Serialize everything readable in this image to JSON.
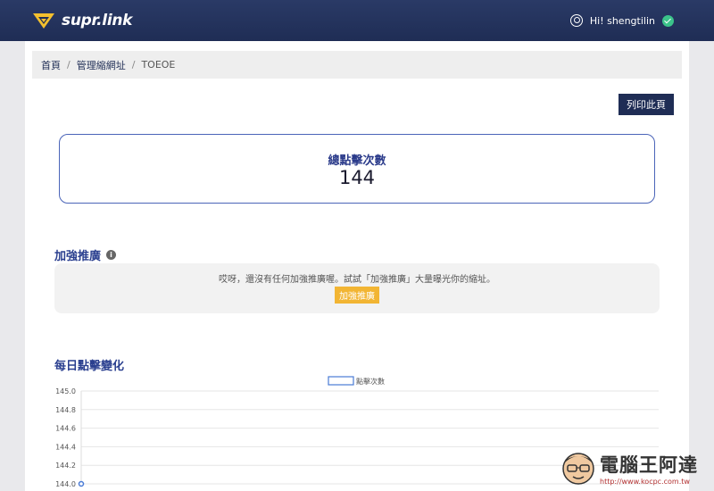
{
  "header": {
    "logo_text": "supr.link",
    "greeting": "Hi! shengtilin"
  },
  "breadcrumb": {
    "home": "首頁",
    "manage": "管理縮網址",
    "current": "TOEOE",
    "separator": "/"
  },
  "toolbar": {
    "print_label": "列印此頁"
  },
  "stats": {
    "total_clicks_label": "總點擊次數",
    "total_clicks_value": "144"
  },
  "promotion": {
    "title": "加強推廣",
    "info": "i",
    "empty_message": "哎呀，還沒有任何加強推廣喔。試試「加強推廣」大量曝光你的縮址。",
    "button_label": "加強推廣"
  },
  "daily": {
    "title": "每日點擊變化"
  },
  "chart_data": {
    "type": "line",
    "legend": [
      "點擊次數"
    ],
    "legend_placement": "top-center",
    "y_ticks": [
      "145.0",
      "144.8",
      "144.6",
      "144.4",
      "144.2",
      "144.0"
    ],
    "ylim": [
      144.0,
      145.0
    ],
    "grid": true,
    "series": [
      {
        "name": "點擊次數",
        "values": [
          144
        ]
      }
    ],
    "colors": {
      "line": "#4a7bd6"
    }
  },
  "watermark": {
    "title": "電腦王阿達",
    "url": "http://www.kocpc.com.tw"
  }
}
